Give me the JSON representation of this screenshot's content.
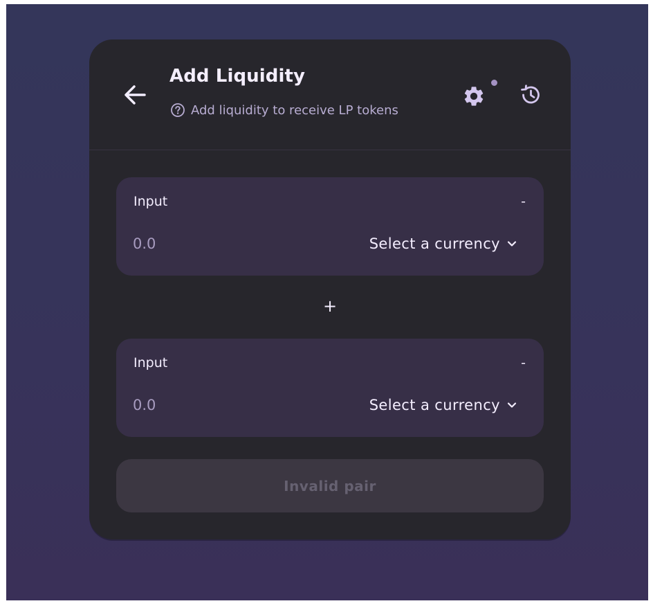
{
  "header": {
    "title": "Add Liquidity",
    "subtitle": "Add liquidity to receive LP tokens",
    "icons": {
      "back": "arrow-left-icon",
      "help": "help-circle-icon",
      "settings": "gear-icon",
      "history": "history-icon"
    }
  },
  "panels": [
    {
      "label": "Input",
      "balance": "-",
      "amount_placeholder": "0.0",
      "currency_label": "Select a currency"
    },
    {
      "label": "Input",
      "balance": "-",
      "amount_placeholder": "0.0",
      "currency_label": "Select a currency"
    }
  ],
  "separator": "+",
  "submit": {
    "label": "Invalid pair",
    "disabled": true
  },
  "colors": {
    "background": "#36345a",
    "card": "#27262c",
    "panel": "#372f47",
    "text_primary": "#f4eeff",
    "text_secondary": "#b8add2",
    "button_disabled_bg": "#3c3742",
    "button_disabled_text": "#666171",
    "indicator_dot": "#a593c4"
  }
}
